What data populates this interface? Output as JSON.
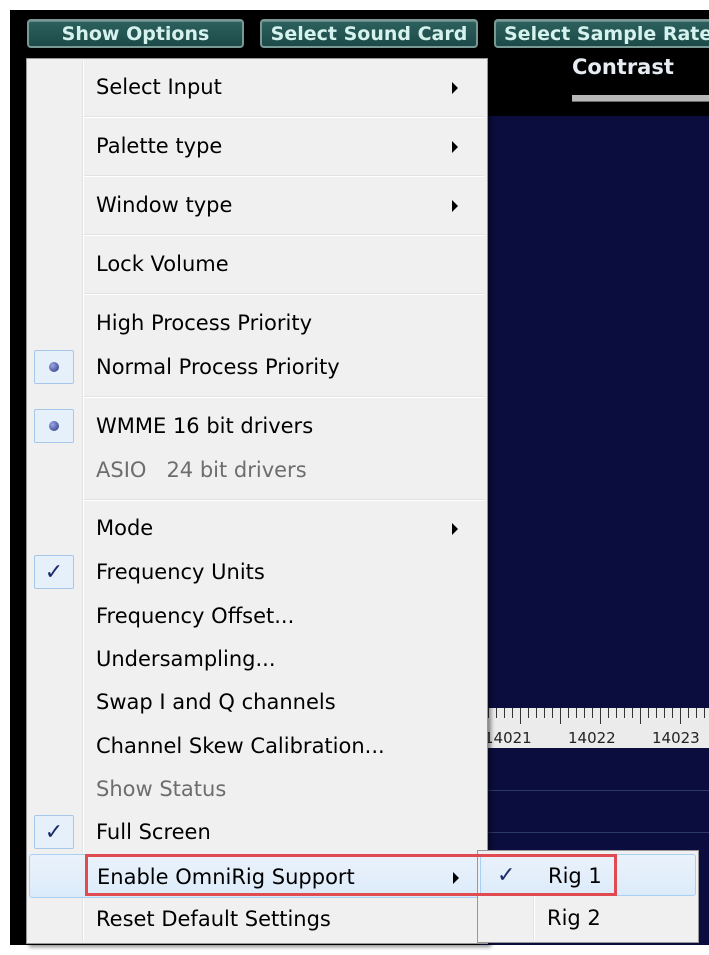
{
  "toolbar": {
    "show_options": "Show Options",
    "select_sound_card": "Select Sound Card",
    "select_sample_rate": "Select Sample Rate"
  },
  "contrast": {
    "label": "Contrast"
  },
  "ruler": {
    "labels": [
      "14021",
      "14022",
      "14023"
    ]
  },
  "menu": {
    "select_input": "Select Input",
    "palette_type": "Palette type",
    "window_type": "Window type",
    "lock_volume": "Lock Volume",
    "high_priority": "High Process Priority",
    "normal_priority": "Normal Process Priority",
    "wmme": "WMME 16 bit drivers",
    "asio": "ASIO   24 bit drivers",
    "mode": "Mode",
    "frequency_units": "Frequency Units",
    "frequency_offset": "Frequency Offset...",
    "undersampling": "Undersampling...",
    "swap_iq": "Swap I and Q channels",
    "skew_calibration": "Channel Skew Calibration...",
    "show_status": "Show Status",
    "full_screen": "Full Screen",
    "enable_omnirig": "Enable OmniRig Support",
    "reset_defaults": "Reset Default Settings"
  },
  "submenu": {
    "rig1": "Rig 1",
    "rig2": "Rig 2"
  },
  "glyphs": {
    "check": "✓"
  },
  "colors": {
    "annotation": "#e04b52",
    "display_bg": "#0b0d3e"
  }
}
